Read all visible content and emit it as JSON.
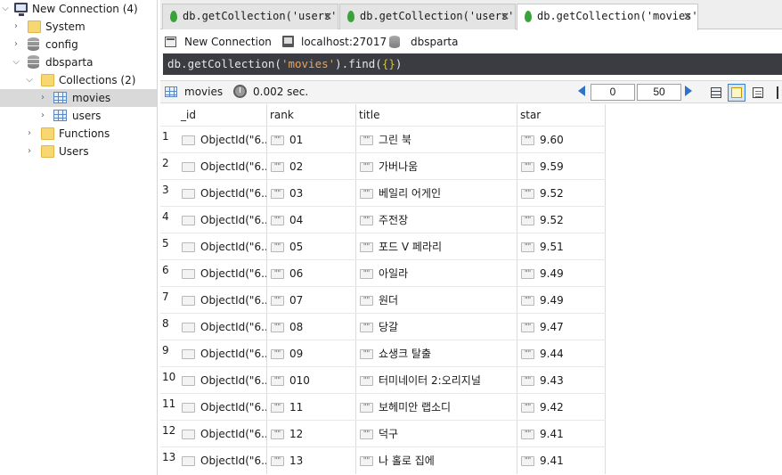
{
  "sidebar": {
    "items": [
      {
        "label": "New Connection (4)",
        "icon": "monitor-icon",
        "expanded": true
      },
      {
        "label": "System",
        "icon": "folder-icon",
        "expanded": false
      },
      {
        "label": "config",
        "icon": "database-icon",
        "expanded": false
      },
      {
        "label": "dbsparta",
        "icon": "database-icon",
        "expanded": true
      },
      {
        "label": "Collections (2)",
        "icon": "folder-icon",
        "expanded": true
      },
      {
        "label": "movies",
        "icon": "collection-grid-icon",
        "expanded": false,
        "selected": true
      },
      {
        "label": "users",
        "icon": "collection-grid-icon",
        "expanded": false
      },
      {
        "label": "Functions",
        "icon": "folder-icon",
        "expanded": false
      },
      {
        "label": "Users",
        "icon": "folder-icon",
        "expanded": false
      }
    ]
  },
  "tabs": [
    {
      "label": "db.getCollection('users').f···",
      "close": "×"
    },
    {
      "label": "db.getCollection('users'),···",
      "close": "×"
    },
    {
      "label": "db.getCollection('movies')···",
      "close": "×",
      "active": true
    }
  ],
  "connbar": {
    "connection": "New Connection",
    "host": "localhost:27017",
    "database": "dbsparta"
  },
  "query": {
    "prefix": "db.getCollection(",
    "collection": "'movies'",
    "middle": ").find(",
    "args": "{}",
    "suffix": ")"
  },
  "result_toolbar": {
    "collection": "movies",
    "elapsed": "0.002 sec.",
    "page_start": "0",
    "page_size": "50"
  },
  "colors": {
    "query_bg": "#3a3c41",
    "query_string": "#e9a45b",
    "pager_arrow": "#2f73c9",
    "selected_tree": "#d9d9d9",
    "tab_leaf": "#3aa23a"
  },
  "table": {
    "columns": [
      "_id",
      "rank",
      "title",
      "star"
    ],
    "rows": [
      {
        "n": "1",
        "id": "ObjectId(\"6...",
        "rank": "01",
        "title": "그린 북",
        "star": "9.60"
      },
      {
        "n": "2",
        "id": "ObjectId(\"6...",
        "rank": "02",
        "title": "가버나움",
        "star": "9.59"
      },
      {
        "n": "3",
        "id": "ObjectId(\"6...",
        "rank": "03",
        "title": "베일리 어게인",
        "star": "9.52"
      },
      {
        "n": "4",
        "id": "ObjectId(\"6...",
        "rank": "04",
        "title": "주전장",
        "star": "9.52"
      },
      {
        "n": "5",
        "id": "ObjectId(\"6...",
        "rank": "05",
        "title": "포드 V 페라리",
        "star": "9.51"
      },
      {
        "n": "6",
        "id": "ObjectId(\"6...",
        "rank": "06",
        "title": "아일라",
        "star": "9.49"
      },
      {
        "n": "7",
        "id": "ObjectId(\"6...",
        "rank": "07",
        "title": "원더",
        "star": "9.49"
      },
      {
        "n": "8",
        "id": "ObjectId(\"6...",
        "rank": "08",
        "title": "당갈",
        "star": "9.47"
      },
      {
        "n": "9",
        "id": "ObjectId(\"6...",
        "rank": "09",
        "title": "쇼생크 탈출",
        "star": "9.44"
      },
      {
        "n": "10",
        "id": "ObjectId(\"6...",
        "rank": "010",
        "title": "터미네이터 2:오리지널",
        "star": "9.43"
      },
      {
        "n": "11",
        "id": "ObjectId(\"6...",
        "rank": "11",
        "title": "보헤미안 랩소디",
        "star": "9.42"
      },
      {
        "n": "12",
        "id": "ObjectId(\"6...",
        "rank": "12",
        "title": "덕구",
        "star": "9.41"
      },
      {
        "n": "13",
        "id": "ObjectId(\"6...",
        "rank": "13",
        "title": "나 홀로 집에",
        "star": "9.41"
      }
    ],
    "string_badge": "\"\""
  }
}
